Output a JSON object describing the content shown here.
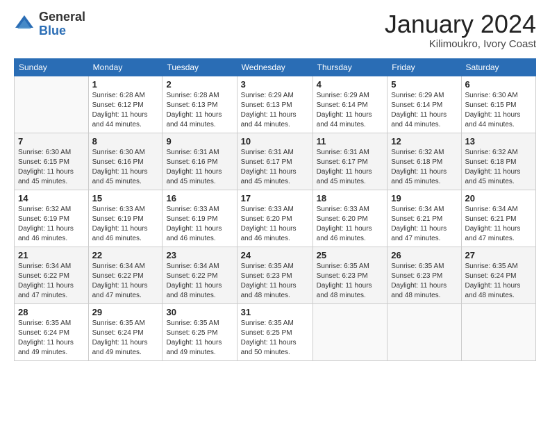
{
  "logo": {
    "general": "General",
    "blue": "Blue"
  },
  "header": {
    "month": "January 2024",
    "location": "Kilimoukro, Ivory Coast"
  },
  "weekdays": [
    "Sunday",
    "Monday",
    "Tuesday",
    "Wednesday",
    "Thursday",
    "Friday",
    "Saturday"
  ],
  "weeks": [
    [
      {
        "day": "",
        "sunrise": "",
        "sunset": "",
        "daylight": ""
      },
      {
        "day": "1",
        "sunrise": "Sunrise: 6:28 AM",
        "sunset": "Sunset: 6:12 PM",
        "daylight": "Daylight: 11 hours and 44 minutes."
      },
      {
        "day": "2",
        "sunrise": "Sunrise: 6:28 AM",
        "sunset": "Sunset: 6:13 PM",
        "daylight": "Daylight: 11 hours and 44 minutes."
      },
      {
        "day": "3",
        "sunrise": "Sunrise: 6:29 AM",
        "sunset": "Sunset: 6:13 PM",
        "daylight": "Daylight: 11 hours and 44 minutes."
      },
      {
        "day": "4",
        "sunrise": "Sunrise: 6:29 AM",
        "sunset": "Sunset: 6:14 PM",
        "daylight": "Daylight: 11 hours and 44 minutes."
      },
      {
        "day": "5",
        "sunrise": "Sunrise: 6:29 AM",
        "sunset": "Sunset: 6:14 PM",
        "daylight": "Daylight: 11 hours and 44 minutes."
      },
      {
        "day": "6",
        "sunrise": "Sunrise: 6:30 AM",
        "sunset": "Sunset: 6:15 PM",
        "daylight": "Daylight: 11 hours and 44 minutes."
      }
    ],
    [
      {
        "day": "7",
        "sunrise": "Sunrise: 6:30 AM",
        "sunset": "Sunset: 6:15 PM",
        "daylight": "Daylight: 11 hours and 45 minutes."
      },
      {
        "day": "8",
        "sunrise": "Sunrise: 6:30 AM",
        "sunset": "Sunset: 6:16 PM",
        "daylight": "Daylight: 11 hours and 45 minutes."
      },
      {
        "day": "9",
        "sunrise": "Sunrise: 6:31 AM",
        "sunset": "Sunset: 6:16 PM",
        "daylight": "Daylight: 11 hours and 45 minutes."
      },
      {
        "day": "10",
        "sunrise": "Sunrise: 6:31 AM",
        "sunset": "Sunset: 6:17 PM",
        "daylight": "Daylight: 11 hours and 45 minutes."
      },
      {
        "day": "11",
        "sunrise": "Sunrise: 6:31 AM",
        "sunset": "Sunset: 6:17 PM",
        "daylight": "Daylight: 11 hours and 45 minutes."
      },
      {
        "day": "12",
        "sunrise": "Sunrise: 6:32 AM",
        "sunset": "Sunset: 6:18 PM",
        "daylight": "Daylight: 11 hours and 45 minutes."
      },
      {
        "day": "13",
        "sunrise": "Sunrise: 6:32 AM",
        "sunset": "Sunset: 6:18 PM",
        "daylight": "Daylight: 11 hours and 45 minutes."
      }
    ],
    [
      {
        "day": "14",
        "sunrise": "Sunrise: 6:32 AM",
        "sunset": "Sunset: 6:19 PM",
        "daylight": "Daylight: 11 hours and 46 minutes."
      },
      {
        "day": "15",
        "sunrise": "Sunrise: 6:33 AM",
        "sunset": "Sunset: 6:19 PM",
        "daylight": "Daylight: 11 hours and 46 minutes."
      },
      {
        "day": "16",
        "sunrise": "Sunrise: 6:33 AM",
        "sunset": "Sunset: 6:19 PM",
        "daylight": "Daylight: 11 hours and 46 minutes."
      },
      {
        "day": "17",
        "sunrise": "Sunrise: 6:33 AM",
        "sunset": "Sunset: 6:20 PM",
        "daylight": "Daylight: 11 hours and 46 minutes."
      },
      {
        "day": "18",
        "sunrise": "Sunrise: 6:33 AM",
        "sunset": "Sunset: 6:20 PM",
        "daylight": "Daylight: 11 hours and 46 minutes."
      },
      {
        "day": "19",
        "sunrise": "Sunrise: 6:34 AM",
        "sunset": "Sunset: 6:21 PM",
        "daylight": "Daylight: 11 hours and 47 minutes."
      },
      {
        "day": "20",
        "sunrise": "Sunrise: 6:34 AM",
        "sunset": "Sunset: 6:21 PM",
        "daylight": "Daylight: 11 hours and 47 minutes."
      }
    ],
    [
      {
        "day": "21",
        "sunrise": "Sunrise: 6:34 AM",
        "sunset": "Sunset: 6:22 PM",
        "daylight": "Daylight: 11 hours and 47 minutes."
      },
      {
        "day": "22",
        "sunrise": "Sunrise: 6:34 AM",
        "sunset": "Sunset: 6:22 PM",
        "daylight": "Daylight: 11 hours and 47 minutes."
      },
      {
        "day": "23",
        "sunrise": "Sunrise: 6:34 AM",
        "sunset": "Sunset: 6:22 PM",
        "daylight": "Daylight: 11 hours and 48 minutes."
      },
      {
        "day": "24",
        "sunrise": "Sunrise: 6:35 AM",
        "sunset": "Sunset: 6:23 PM",
        "daylight": "Daylight: 11 hours and 48 minutes."
      },
      {
        "day": "25",
        "sunrise": "Sunrise: 6:35 AM",
        "sunset": "Sunset: 6:23 PM",
        "daylight": "Daylight: 11 hours and 48 minutes."
      },
      {
        "day": "26",
        "sunrise": "Sunrise: 6:35 AM",
        "sunset": "Sunset: 6:23 PM",
        "daylight": "Daylight: 11 hours and 48 minutes."
      },
      {
        "day": "27",
        "sunrise": "Sunrise: 6:35 AM",
        "sunset": "Sunset: 6:24 PM",
        "daylight": "Daylight: 11 hours and 48 minutes."
      }
    ],
    [
      {
        "day": "28",
        "sunrise": "Sunrise: 6:35 AM",
        "sunset": "Sunset: 6:24 PM",
        "daylight": "Daylight: 11 hours and 49 minutes."
      },
      {
        "day": "29",
        "sunrise": "Sunrise: 6:35 AM",
        "sunset": "Sunset: 6:24 PM",
        "daylight": "Daylight: 11 hours and 49 minutes."
      },
      {
        "day": "30",
        "sunrise": "Sunrise: 6:35 AM",
        "sunset": "Sunset: 6:25 PM",
        "daylight": "Daylight: 11 hours and 49 minutes."
      },
      {
        "day": "31",
        "sunrise": "Sunrise: 6:35 AM",
        "sunset": "Sunset: 6:25 PM",
        "daylight": "Daylight: 11 hours and 50 minutes."
      },
      {
        "day": "",
        "sunrise": "",
        "sunset": "",
        "daylight": ""
      },
      {
        "day": "",
        "sunrise": "",
        "sunset": "",
        "daylight": ""
      },
      {
        "day": "",
        "sunrise": "",
        "sunset": "",
        "daylight": ""
      }
    ]
  ]
}
